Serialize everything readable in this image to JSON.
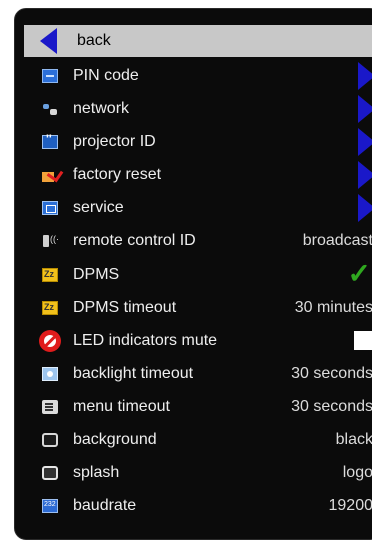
{
  "menu": {
    "back_label": "back",
    "items": [
      {
        "label": "PIN code",
        "icon": "pin-code-icon",
        "value": "",
        "control": "submenu"
      },
      {
        "label": "network",
        "icon": "network-icon",
        "value": "",
        "control": "submenu"
      },
      {
        "label": "projector ID",
        "icon": "projector-id-icon",
        "value": "",
        "control": "submenu"
      },
      {
        "label": "factory reset",
        "icon": "factory-reset-icon",
        "value": "",
        "control": "submenu"
      },
      {
        "label": "service",
        "icon": "service-icon",
        "value": "",
        "control": "submenu"
      },
      {
        "label": "remote control ID",
        "icon": "remote-control-icon",
        "value": "broadcast",
        "control": "value"
      },
      {
        "label": "DPMS",
        "icon": "dpms-icon",
        "value": "",
        "control": "checked"
      },
      {
        "label": "DPMS timeout",
        "icon": "dpms-timeout-icon",
        "value": "30 minutes",
        "control": "value"
      },
      {
        "label": "LED indicators mute",
        "icon": "led-mute-icon",
        "value": "",
        "control": "unchecked"
      },
      {
        "label": "backlight timeout",
        "icon": "backlight-icon",
        "value": "30 seconds",
        "control": "value"
      },
      {
        "label": "menu timeout",
        "icon": "menu-timeout-icon",
        "value": "30 seconds",
        "control": "value"
      },
      {
        "label": "background",
        "icon": "background-icon",
        "value": "black",
        "control": "value"
      },
      {
        "label": "splash",
        "icon": "splash-icon",
        "value": "logo",
        "control": "value"
      },
      {
        "label": "baudrate",
        "icon": "baudrate-icon",
        "value": "19200",
        "control": "value"
      }
    ]
  },
  "colors": {
    "panel_bg": "#0b0b0b",
    "selected_row_bg": "#c8c8c8",
    "arrow_blue": "#1a18c9",
    "check_green": "#2fa81f",
    "mute_red": "#e01c1c"
  }
}
